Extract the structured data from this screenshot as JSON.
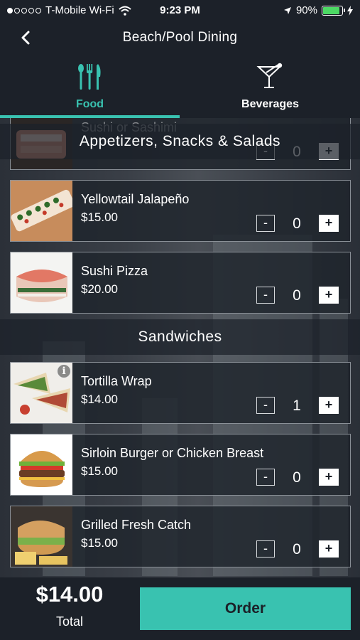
{
  "status_bar": {
    "carrier": "T-Mobile Wi-Fi",
    "time": "9:23 PM",
    "battery": "90%",
    "battery_level": 0.9
  },
  "header": {
    "title": "Beach/Pool Dining",
    "back_icon": "chevron-left-icon"
  },
  "tabs": [
    {
      "label": "Food",
      "icon": "fork-knife-icon",
      "active": true,
      "color": "#39c2b0"
    },
    {
      "label": "Beverages",
      "icon": "cocktail-icon",
      "active": false
    }
  ],
  "sections": [
    {
      "title": "Appetizers, Snacks & Salads",
      "items": [
        {
          "name": "Sushi or Sashimi",
          "price": "",
          "quantity": "0"
        },
        {
          "name": "Yellowtail Jalapeño",
          "price": "$15.00",
          "quantity": "0"
        },
        {
          "name": "Sushi Pizza",
          "price": "$20.00",
          "quantity": "0"
        }
      ]
    },
    {
      "title": "Sandwiches",
      "items": [
        {
          "name": "Tortilla Wrap",
          "price": "$14.00",
          "quantity": "1",
          "info": "i"
        },
        {
          "name": "Sirloin Burger or Chicken Breast",
          "price": "$15.00",
          "quantity": "0"
        },
        {
          "name": "Grilled Fresh Catch",
          "price": "$15.00",
          "quantity": "0"
        }
      ]
    }
  ],
  "stepper": {
    "minus": "-",
    "plus": "+"
  },
  "footer": {
    "total_amount": "$14.00",
    "total_label": "Total",
    "order_label": "Order"
  },
  "colors": {
    "accent": "#39c2b0",
    "bar_bg": "#1c2129"
  }
}
